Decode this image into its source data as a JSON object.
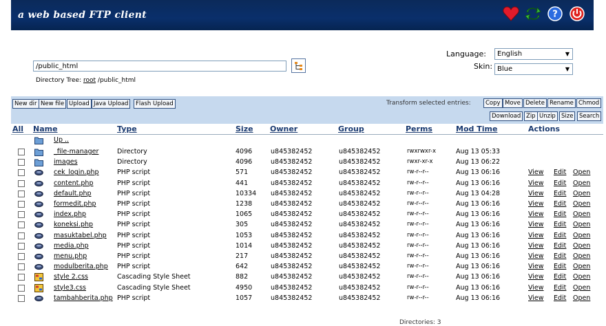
{
  "header": {
    "tagline": "a web based FTP client"
  },
  "location": {
    "path": "/public_html",
    "tree_label": "Directory Tree:",
    "tree_root": "root",
    "tree_path": "/public_html"
  },
  "settings": {
    "language_label": "Language:",
    "language_value": "English",
    "skin_label": "Skin:",
    "skin_value": "Blue"
  },
  "toolbar": {
    "left_buttons": [
      "New dir",
      "New file",
      "Upload",
      "Java Upload",
      "Flash Upload"
    ],
    "transform_label": "Transform selected entries:",
    "row1_buttons": [
      "Copy",
      "Move",
      "Delete",
      "Rename",
      "Chmod"
    ],
    "row2_buttons": [
      "Download",
      "Zip",
      "Unzip",
      "Size",
      "Search"
    ]
  },
  "table": {
    "headers": {
      "all": "All",
      "name": "Name",
      "type": "Type",
      "size": "Size",
      "owner": "Owner",
      "group": "Group",
      "perms": "Perms",
      "modtime": "Mod Time",
      "actions": "Actions"
    },
    "up_label": "Up ..",
    "action_labels": [
      "View",
      "Edit",
      "Open"
    ],
    "rows": [
      {
        "icon": "folder",
        "name": "_file-manager",
        "type": "Directory",
        "size": "4096",
        "owner": "u845382452",
        "group": "u845382452",
        "perms": "rwxrwxr-x",
        "mtime": "Aug 13 05:33",
        "actions": false
      },
      {
        "icon": "folder",
        "name": "images",
        "type": "Directory",
        "size": "4096",
        "owner": "u845382452",
        "group": "u845382452",
        "perms": "rwxr-xr-x",
        "mtime": "Aug 13 06:22",
        "actions": false
      },
      {
        "icon": "php",
        "name": "cek_login.php",
        "type": "PHP script",
        "size": "571",
        "owner": "u845382452",
        "group": "u845382452",
        "perms": "rw-r--r--",
        "mtime": "Aug 13 06:16",
        "actions": true
      },
      {
        "icon": "php",
        "name": "content.php",
        "type": "PHP script",
        "size": "441",
        "owner": "u845382452",
        "group": "u845382452",
        "perms": "rw-r--r--",
        "mtime": "Aug 13 06:16",
        "actions": true
      },
      {
        "icon": "php",
        "name": "default.php",
        "type": "PHP script",
        "size": "10334",
        "owner": "u845382452",
        "group": "u845382452",
        "perms": "rw-r--r--",
        "mtime": "Aug 13 04:28",
        "actions": true
      },
      {
        "icon": "php",
        "name": "formedit.php",
        "type": "PHP script",
        "size": "1238",
        "owner": "u845382452",
        "group": "u845382452",
        "perms": "rw-r--r--",
        "mtime": "Aug 13 06:16",
        "actions": true
      },
      {
        "icon": "php",
        "name": "index.php",
        "type": "PHP script",
        "size": "1065",
        "owner": "u845382452",
        "group": "u845382452",
        "perms": "rw-r--r--",
        "mtime": "Aug 13 06:16",
        "actions": true
      },
      {
        "icon": "php",
        "name": "koneksi.php",
        "type": "PHP script",
        "size": "305",
        "owner": "u845382452",
        "group": "u845382452",
        "perms": "rw-r--r--",
        "mtime": "Aug 13 06:16",
        "actions": true
      },
      {
        "icon": "php",
        "name": "masuktabel.php",
        "type": "PHP script",
        "size": "1053",
        "owner": "u845382452",
        "group": "u845382452",
        "perms": "rw-r--r--",
        "mtime": "Aug 13 06:16",
        "actions": true
      },
      {
        "icon": "php",
        "name": "media.php",
        "type": "PHP script",
        "size": "1014",
        "owner": "u845382452",
        "group": "u845382452",
        "perms": "rw-r--r--",
        "mtime": "Aug 13 06:16",
        "actions": true
      },
      {
        "icon": "php",
        "name": "menu.php",
        "type": "PHP script",
        "size": "217",
        "owner": "u845382452",
        "group": "u845382452",
        "perms": "rw-r--r--",
        "mtime": "Aug 13 06:16",
        "actions": true
      },
      {
        "icon": "php",
        "name": "modulberita.php",
        "type": "PHP script",
        "size": "642",
        "owner": "u845382452",
        "group": "u845382452",
        "perms": "rw-r--r--",
        "mtime": "Aug 13 06:16",
        "actions": true
      },
      {
        "icon": "css",
        "name": "style 2.css",
        "type": "Cascading Style Sheet",
        "size": "882",
        "owner": "u845382452",
        "group": "u845382452",
        "perms": "rw-r--r--",
        "mtime": "Aug 13 06:16",
        "actions": true
      },
      {
        "icon": "css",
        "name": "style3.css",
        "type": "Cascading Style Sheet",
        "size": "4950",
        "owner": "u845382452",
        "group": "u845382452",
        "perms": "rw-r--r--",
        "mtime": "Aug 13 06:16",
        "actions": true
      },
      {
        "icon": "php",
        "name": "tambahberita.php",
        "type": "PHP script",
        "size": "1057",
        "owner": "u845382452",
        "group": "u845382452",
        "perms": "rw-r--r--",
        "mtime": "Aug 13 06:16",
        "actions": true
      }
    ]
  },
  "footer": {
    "text": "Directories: 3"
  }
}
